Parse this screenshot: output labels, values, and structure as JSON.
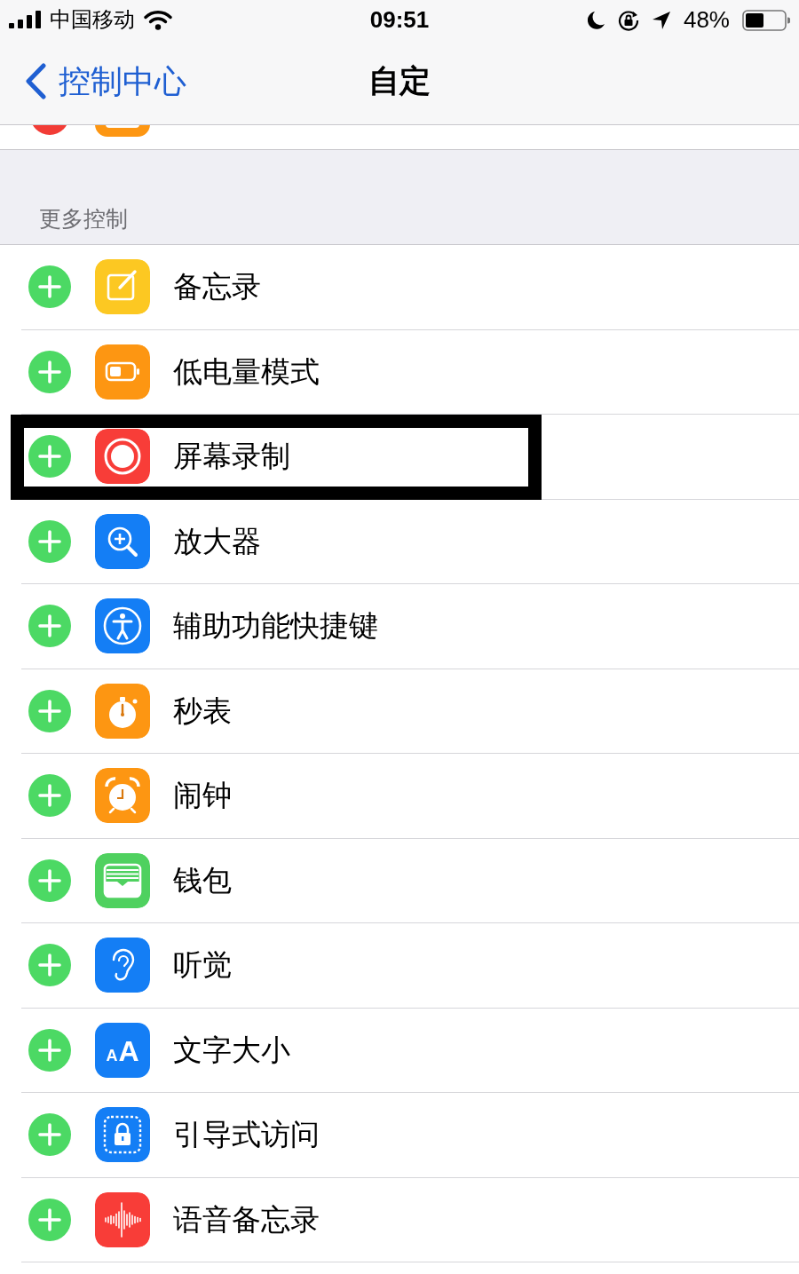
{
  "status_bar": {
    "carrier": "中国移动",
    "time": "09:51",
    "battery": "48%"
  },
  "nav_bar": {
    "back": "控制中心",
    "title": "自定"
  },
  "section": {
    "header": "更多控制",
    "items": [
      {
        "label": "备忘录",
        "kind": "notes",
        "highlighted": false
      },
      {
        "label": "低电量模式",
        "kind": "battery",
        "highlighted": false
      },
      {
        "label": "屏幕录制",
        "kind": "record",
        "highlighted": true
      },
      {
        "label": "放大器",
        "kind": "magnifier",
        "highlighted": false
      },
      {
        "label": "辅助功能快捷键",
        "kind": "accessibility",
        "highlighted": false
      },
      {
        "label": "秒表",
        "kind": "stopwatch",
        "highlighted": false
      },
      {
        "label": "闹钟",
        "kind": "alarm",
        "highlighted": false
      },
      {
        "label": "钱包",
        "kind": "wallet",
        "highlighted": false
      },
      {
        "label": "听觉",
        "kind": "ear",
        "highlighted": false
      },
      {
        "label": "文字大小",
        "kind": "textsize",
        "icon_text": [
          "A",
          "A"
        ],
        "highlighted": false
      },
      {
        "label": "引导式访问",
        "kind": "lock",
        "highlighted": false
      },
      {
        "label": "语音备忘录",
        "kind": "waveform",
        "highlighted": false
      }
    ]
  }
}
